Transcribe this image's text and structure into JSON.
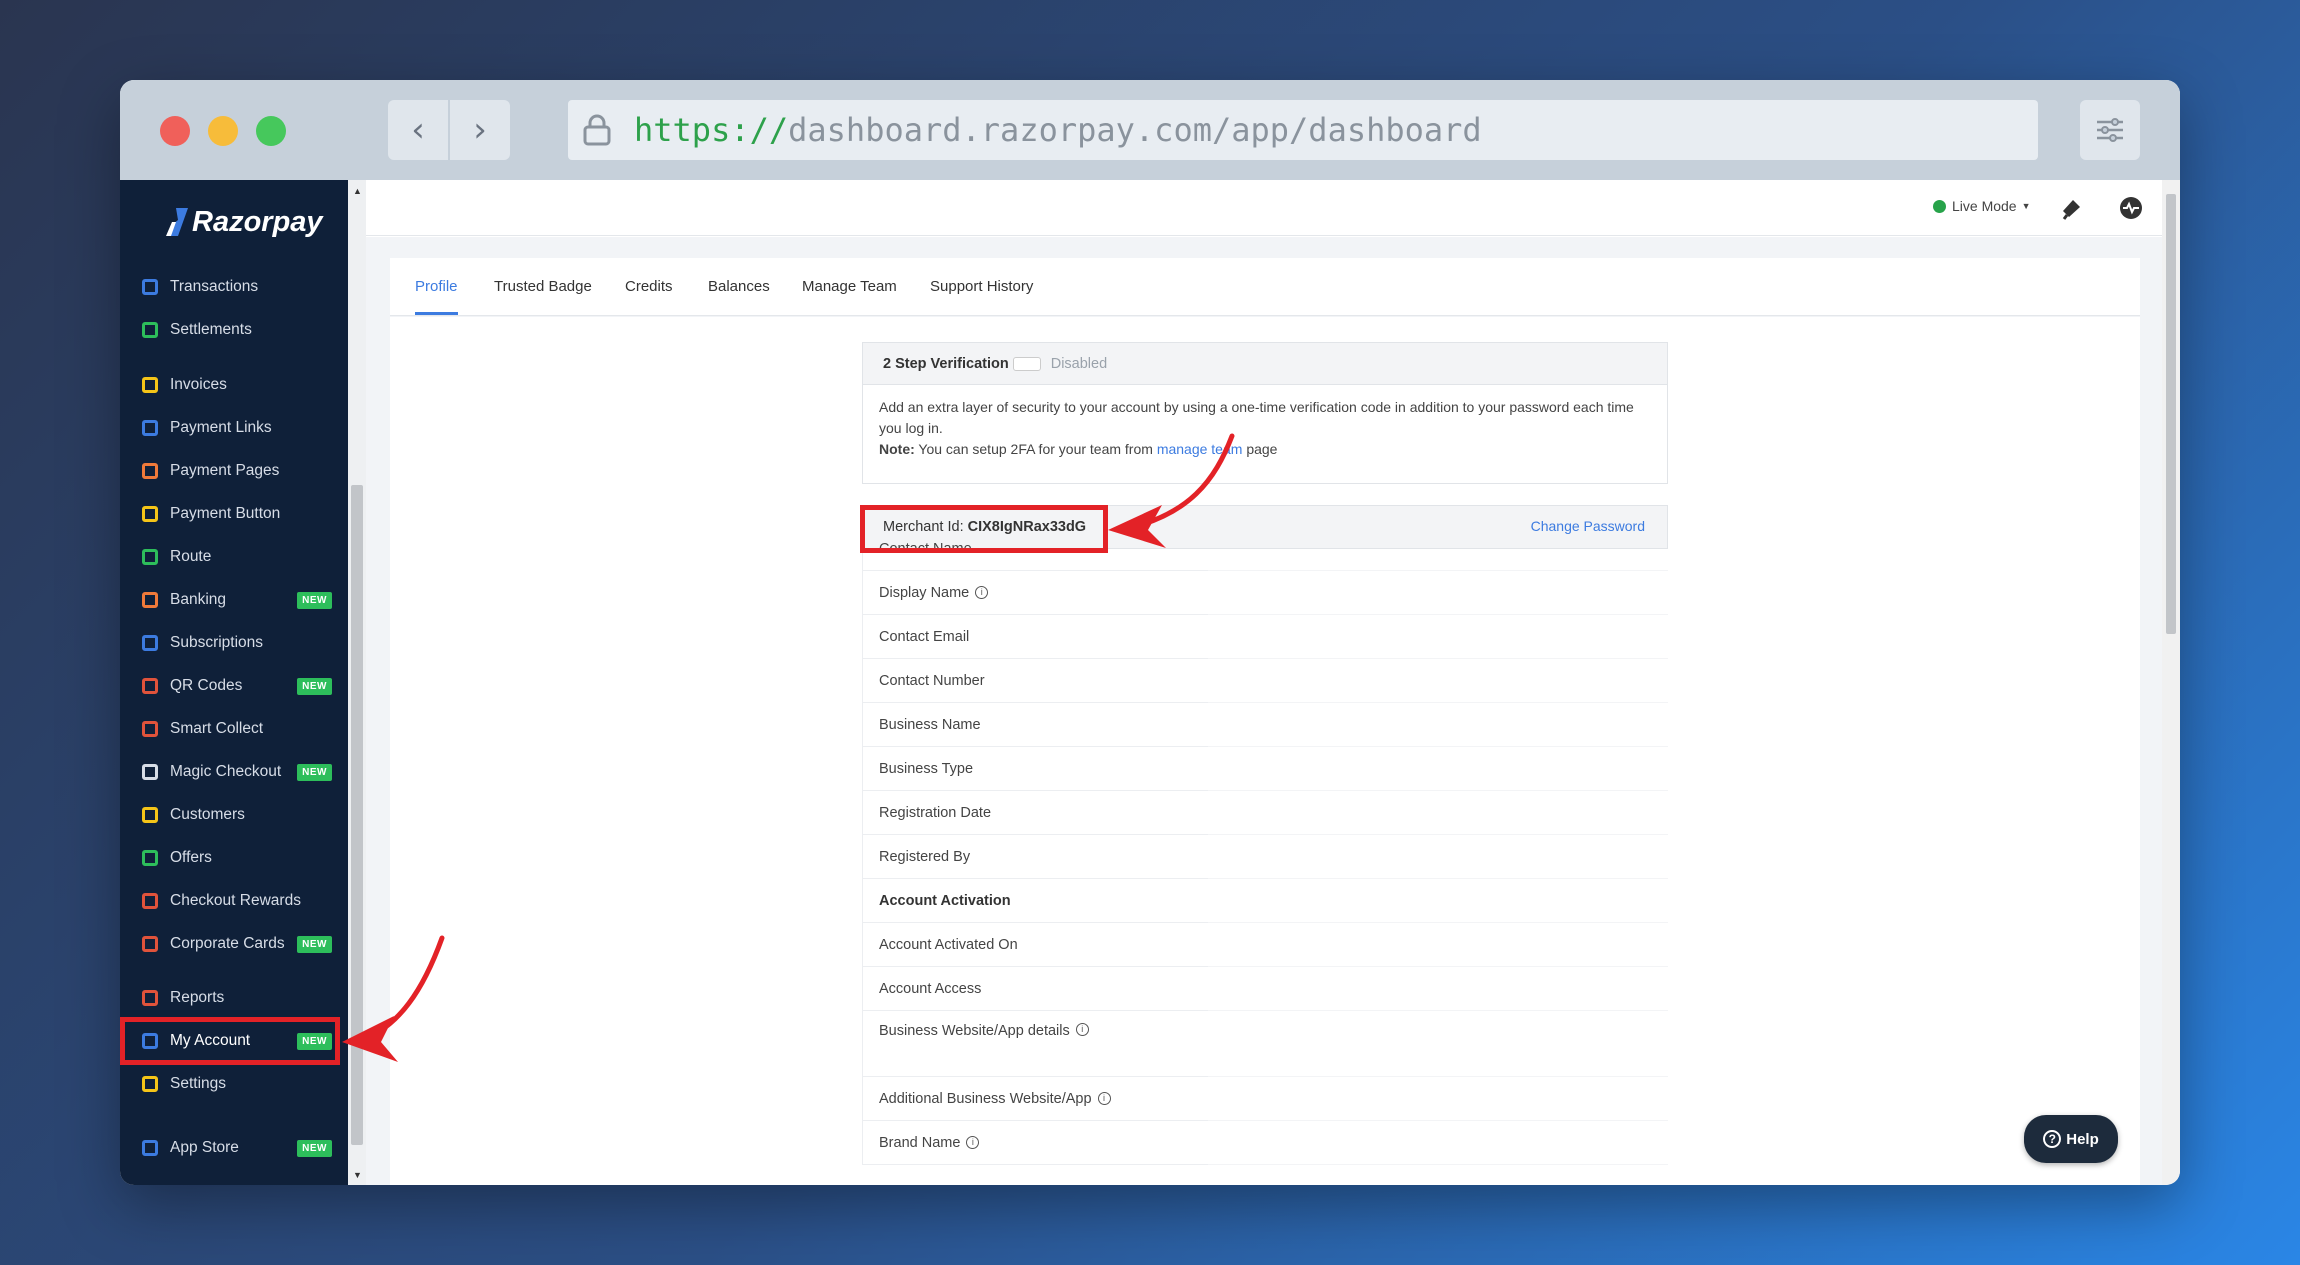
{
  "browser": {
    "url_scheme": "https://",
    "url_rest": "dashboard.razorpay.com/app/dashboard"
  },
  "brand": {
    "name": "Razorpay"
  },
  "sidebar": {
    "items": [
      {
        "label": "Transactions",
        "icon": "transactions-icon",
        "color": "#3c7be0",
        "badge": ""
      },
      {
        "label": "Settlements",
        "icon": "settlements-icon",
        "color": "#2dbe5b",
        "badge": ""
      },
      {
        "label": "Invoices",
        "icon": "invoices-icon",
        "color": "#f5c518",
        "badge": ""
      },
      {
        "label": "Payment Links",
        "icon": "payment-links-icon",
        "color": "#3c7be0",
        "badge": ""
      },
      {
        "label": "Payment Pages",
        "icon": "payment-pages-icon",
        "color": "#f07a3a",
        "badge": ""
      },
      {
        "label": "Payment Button",
        "icon": "payment-button-icon",
        "color": "#f5c518",
        "badge": ""
      },
      {
        "label": "Route",
        "icon": "route-icon",
        "color": "#2dbe5b",
        "badge": ""
      },
      {
        "label": "Banking",
        "icon": "banking-icon",
        "color": "#f07a3a",
        "badge": "NEW"
      },
      {
        "label": "Subscriptions",
        "icon": "subscriptions-icon",
        "color": "#3c7be0",
        "badge": ""
      },
      {
        "label": "QR Codes",
        "icon": "qr-codes-icon",
        "color": "#e0533b",
        "badge": "NEW"
      },
      {
        "label": "Smart Collect",
        "icon": "smart-collect-icon",
        "color": "#e0533b",
        "badge": ""
      },
      {
        "label": "Magic Checkout",
        "icon": "magic-checkout-icon",
        "color": "#d7dde7",
        "badge": "NEW"
      },
      {
        "label": "Customers",
        "icon": "customers-icon",
        "color": "#f5c518",
        "badge": ""
      },
      {
        "label": "Offers",
        "icon": "offers-icon",
        "color": "#2dbe5b",
        "badge": ""
      },
      {
        "label": "Checkout Rewards",
        "icon": "checkout-rewards-icon",
        "color": "#e0533b",
        "badge": ""
      },
      {
        "label": "Corporate Cards",
        "icon": "corporate-cards-icon",
        "color": "#e0533b",
        "badge": "NEW"
      },
      {
        "label": "Reports",
        "icon": "reports-icon",
        "color": "#e0533b",
        "badge": ""
      },
      {
        "label": "My Account",
        "icon": "my-account-icon",
        "color": "#3c7be0",
        "badge": "NEW"
      },
      {
        "label": "Settings",
        "icon": "settings-icon",
        "color": "#f5c518",
        "badge": ""
      },
      {
        "label": "App Store",
        "icon": "app-store-icon",
        "color": "#3c7be0",
        "badge": "NEW"
      }
    ]
  },
  "topbar": {
    "mode": "Live Mode"
  },
  "tabs": [
    "Profile",
    "Trusted Badge",
    "Credits",
    "Balances",
    "Manage Team",
    "Support History"
  ],
  "twofa": {
    "title": "2 Step Verification",
    "status": "Disabled",
    "desc": "Add an extra layer of security to your account by using a one-time verification code in addition to your password each time you log in.",
    "note_label": "Note:",
    "note_text": "You can setup 2FA for your team from",
    "note_link": "manage team",
    "note_suffix": "page"
  },
  "profile": {
    "merchant_label": "Merchant Id:",
    "merchant_id": "CIX8IgNRax33dG",
    "change_password": "Change Password",
    "rows": [
      "Contact Name",
      "Display Name",
      "Contact Email",
      "Contact Number",
      "Business Name",
      "Business Type",
      "Registration Date",
      "Registered By",
      "Account Activation",
      "Account Activated On",
      "Account Access",
      "Business Website/App details",
      "Additional Business Website/App",
      "Brand Name"
    ]
  },
  "help": {
    "label": "Help"
  },
  "colors": {
    "accent": "#3c7be0",
    "sidebar_bg": "#0f2039",
    "highlight": "#e32227",
    "badge_green": "#2dbe5b"
  }
}
